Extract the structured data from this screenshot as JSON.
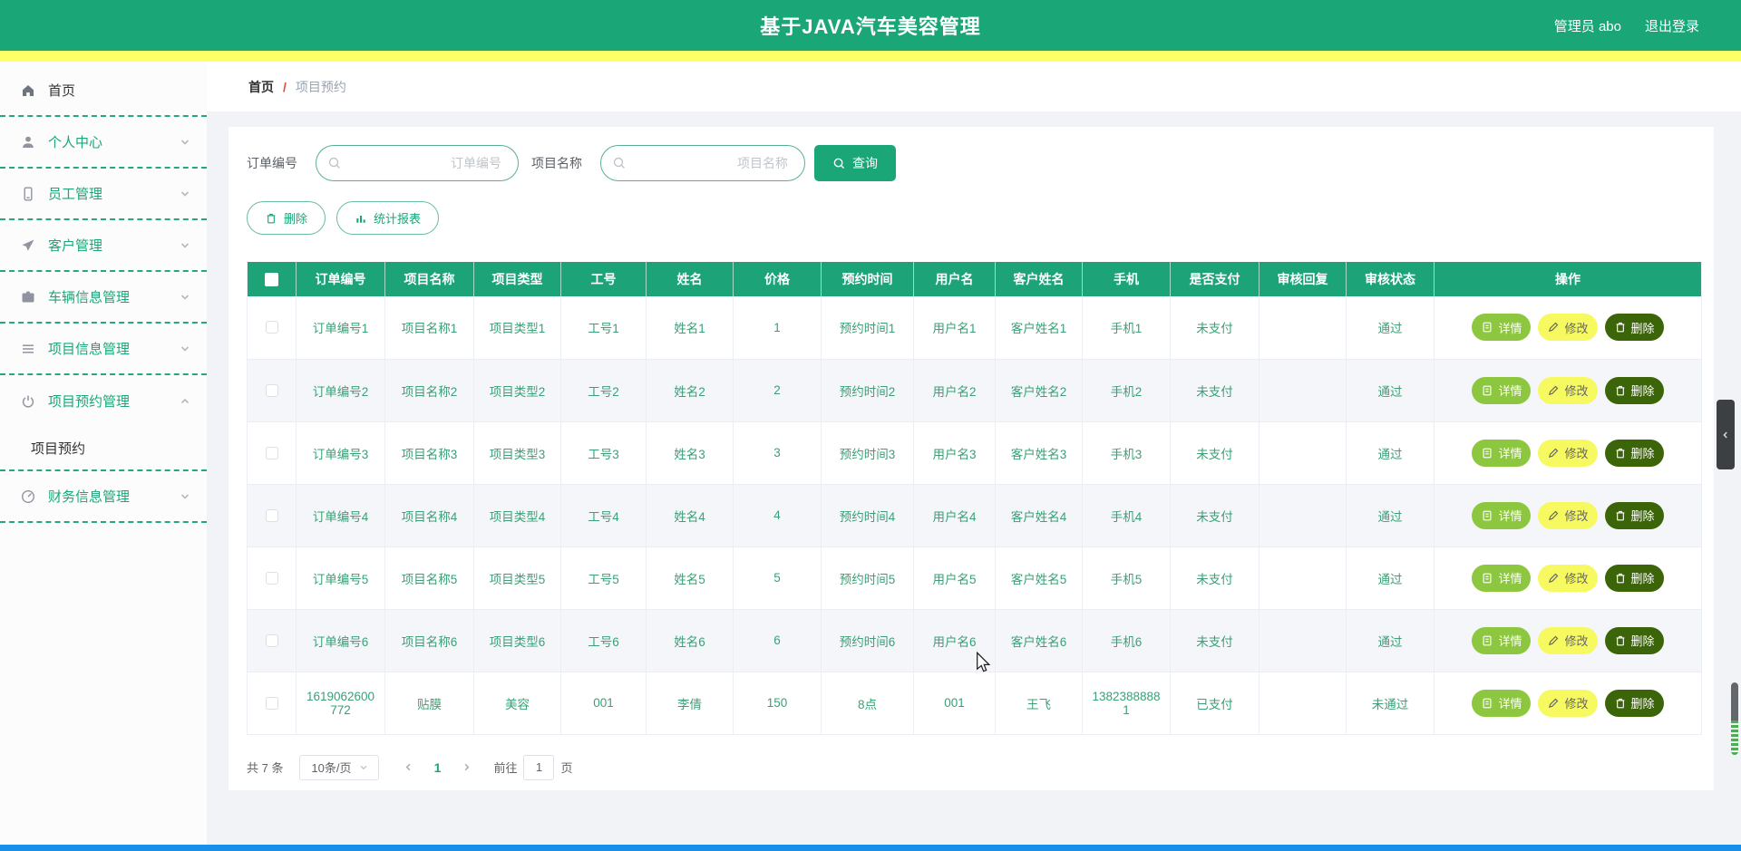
{
  "header": {
    "title": "基于JAVA汽车美容管理",
    "user": "管理员 abo",
    "logout": "退出登录"
  },
  "sidebar": {
    "items": [
      {
        "label": "首页",
        "icon": "home-icon"
      },
      {
        "label": "个人中心",
        "icon": "user-icon",
        "chevron": "down"
      },
      {
        "label": "员工管理",
        "icon": "phone-icon",
        "chevron": "down"
      },
      {
        "label": "客户管理",
        "icon": "send-icon",
        "chevron": "down"
      },
      {
        "label": "车辆信息管理",
        "icon": "briefcase-icon",
        "chevron": "down"
      },
      {
        "label": "项目信息管理",
        "icon": "list-icon",
        "chevron": "down"
      },
      {
        "label": "项目预约管理",
        "icon": "power-icon",
        "chevron": "up",
        "expanded": true
      },
      {
        "label": "财务信息管理",
        "icon": "gauge-icon",
        "chevron": "down"
      }
    ],
    "submenu": {
      "label": "项目预约",
      "active": true
    }
  },
  "breadcrumb": {
    "root": "首页",
    "separator": "/",
    "current": "项目预约"
  },
  "search": {
    "order_label": "订单编号",
    "order_placeholder": "订单编号",
    "order_value": "",
    "project_label": "项目名称",
    "project_placeholder": "项目名称",
    "project_value": "",
    "submit_label": "查询"
  },
  "toolbar": {
    "delete_label": "删除",
    "report_label": "统计报表"
  },
  "table": {
    "columns": [
      "订单编号",
      "项目名称",
      "项目类型",
      "工号",
      "姓名",
      "价格",
      "预约时间",
      "用户名",
      "客户姓名",
      "手机",
      "是否支付",
      "审核回复",
      "审核状态",
      "操作"
    ],
    "rows": [
      [
        "订单编号1",
        "项目名称1",
        "项目类型1",
        "工号1",
        "姓名1",
        "1",
        "预约时间1",
        "用户名1",
        "客户姓名1",
        "手机1",
        "未支付",
        "",
        "通过"
      ],
      [
        "订单编号2",
        "项目名称2",
        "项目类型2",
        "工号2",
        "姓名2",
        "2",
        "预约时间2",
        "用户名2",
        "客户姓名2",
        "手机2",
        "未支付",
        "",
        "通过"
      ],
      [
        "订单编号3",
        "项目名称3",
        "项目类型3",
        "工号3",
        "姓名3",
        "3",
        "预约时间3",
        "用户名3",
        "客户姓名3",
        "手机3",
        "未支付",
        "",
        "通过"
      ],
      [
        "订单编号4",
        "项目名称4",
        "项目类型4",
        "工号4",
        "姓名4",
        "4",
        "预约时间4",
        "用户名4",
        "客户姓名4",
        "手机4",
        "未支付",
        "",
        "通过"
      ],
      [
        "订单编号5",
        "项目名称5",
        "项目类型5",
        "工号5",
        "姓名5",
        "5",
        "预约时间5",
        "用户名5",
        "客户姓名5",
        "手机5",
        "未支付",
        "",
        "通过"
      ],
      [
        "订单编号6",
        "项目名称6",
        "项目类型6",
        "工号6",
        "姓名6",
        "6",
        "预约时间6",
        "用户名6",
        "客户姓名6",
        "手机6",
        "未支付",
        "",
        "通过"
      ],
      [
        "1619062600772",
        "贴膜",
        "美容",
        "001",
        "李倩",
        "150",
        "8点",
        "001",
        "王飞",
        "13823888881",
        "已支付",
        "",
        "未通过"
      ]
    ],
    "actions": {
      "detail": "详情",
      "edit": "修改",
      "delete": "删除"
    }
  },
  "pagination": {
    "total": "共 7 条",
    "page_size": "10条/页",
    "page": "1",
    "goto_label": "前往",
    "goto_value": "1",
    "page_unit": "页"
  },
  "colors": {
    "primary_green": "#1ba678",
    "header_yellow": "#fdff68",
    "cell_text_green": "#3aa076",
    "action_detail_bg": "#8dc63f",
    "action_edit_bg": "#f6f960",
    "action_delete_bg": "#3b6508",
    "bottom_strip_blue": "#1690e8",
    "breadcrumb_separator_red": "#ee4433"
  }
}
